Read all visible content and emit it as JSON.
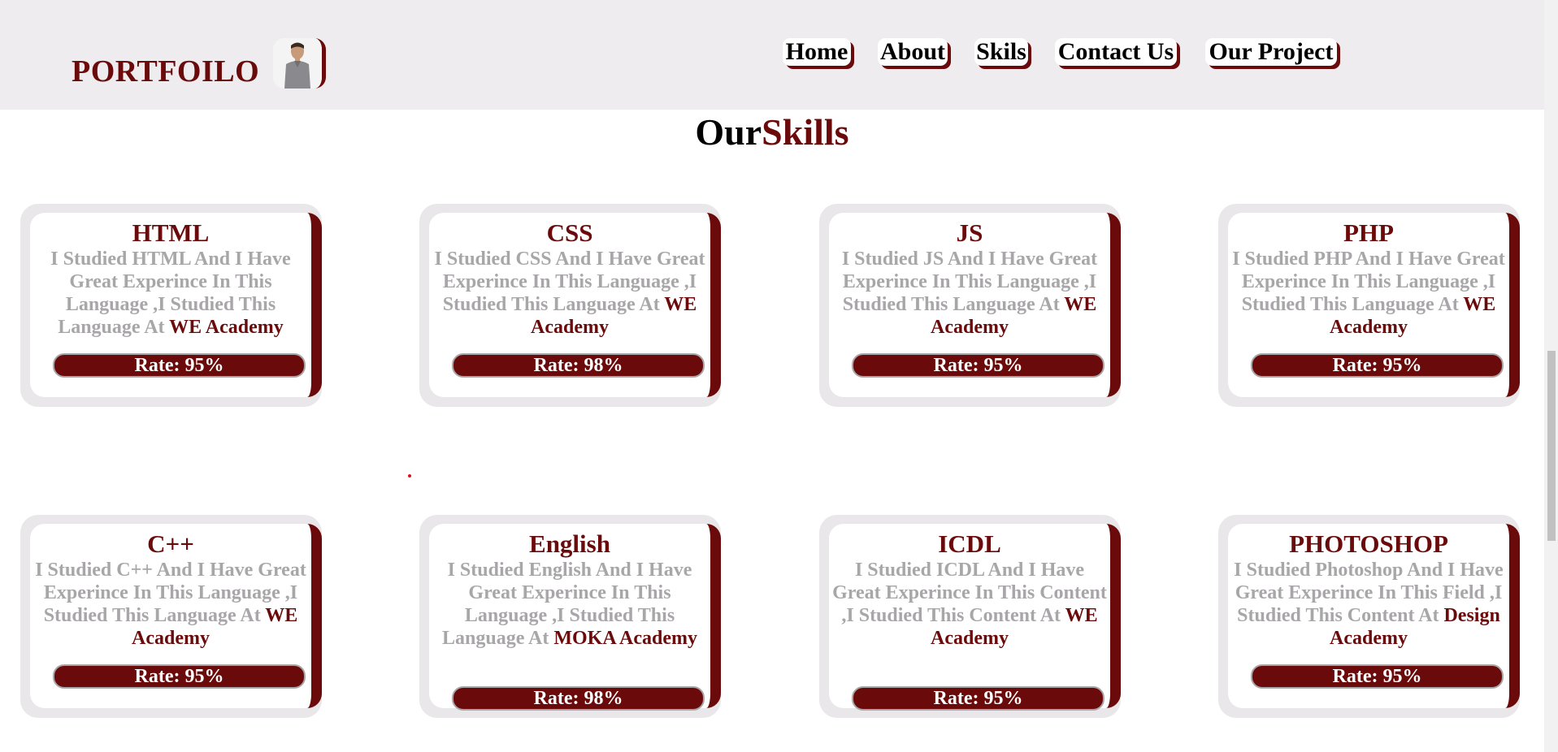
{
  "header": {
    "brand": "PORTFOILO",
    "nav": [
      {
        "label": "Home"
      },
      {
        "label": "About"
      },
      {
        "label": "Skils"
      },
      {
        "label": "Contact Us"
      },
      {
        "label": "Our Project"
      }
    ]
  },
  "section": {
    "title_part1": "Our",
    "title_part2": "Skills"
  },
  "skills": [
    {
      "title": "HTML",
      "desc": "I Studied HTML And I Have Great Experince In This Language ,I Studied This Language At",
      "academy": "WE Academy",
      "rate": "Rate: 95%"
    },
    {
      "title": "CSS",
      "desc": "I Studied CSS And I Have Great Experince In This Language ,I Studied This Language At",
      "academy": "WE Academy",
      "rate": "Rate: 98%"
    },
    {
      "title": "JS",
      "desc": "I Studied JS And I Have Great Experince In This Language ,I Studied This Language At",
      "academy": "WE Academy",
      "rate": "Rate: 95%"
    },
    {
      "title": "PHP",
      "desc": "I Studied PHP And I Have Great Experince In This Language ,I Studied This Language At",
      "academy": "WE Academy",
      "rate": "Rate: 95%"
    },
    {
      "title": "C++",
      "desc": "I Studied C++ And I Have Great Experince In This Language ,I Studied This Language At",
      "academy": "WE Academy",
      "rate": "Rate: 95%"
    },
    {
      "title": "English",
      "desc": "I Studied English And I Have Great Experince In This Language ,I Studied This Language At",
      "academy": "MOKA Academy",
      "rate": "Rate: 98%"
    },
    {
      "title": "ICDL",
      "desc": "I Studied ICDL And I Have Great Experince In This Content ,I Studied This Content At",
      "academy": "WE Academy",
      "rate": "Rate: 95%"
    },
    {
      "title": "PHOTOSHOP",
      "desc": "I Studied Photoshop And I Have Great Experince In This Field ,I Studied This Content At",
      "academy": "Design Academy",
      "rate": "Rate: 95%"
    }
  ]
}
